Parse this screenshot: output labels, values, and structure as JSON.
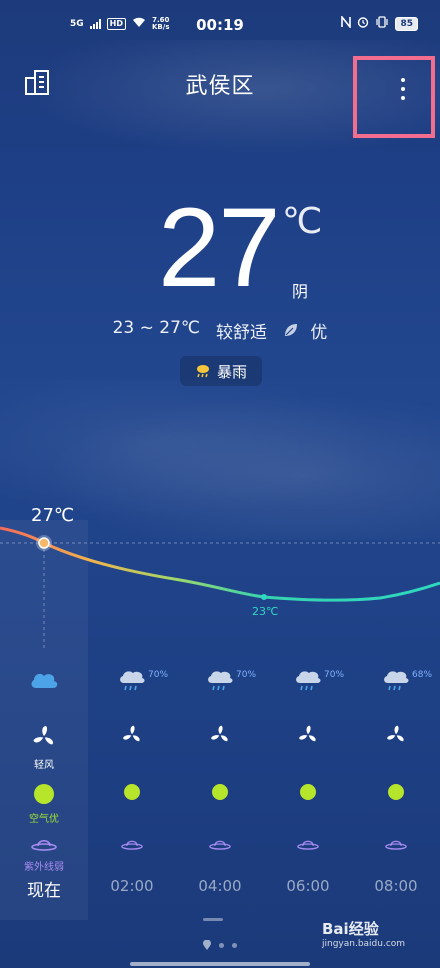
{
  "status": {
    "network": "5G",
    "hd": "HD",
    "speed_value": "7.60",
    "speed_unit": "KB/s",
    "time": "00:19",
    "battery": "85"
  },
  "header": {
    "title": "武侯区"
  },
  "current": {
    "temp": "27",
    "unit": "℃",
    "condition": "阴",
    "range": "23 ~ 27℃",
    "comfort": "较舒适",
    "air_quality": "优"
  },
  "alert": {
    "label": "暴雨"
  },
  "chart_labels": {
    "now_temp": "27℃",
    "min_temp": "23℃"
  },
  "hourly": [
    {
      "time": "现在",
      "pop": "",
      "wind": "轻风",
      "aqi": "空气优",
      "uv": "紫外线弱"
    },
    {
      "time": "02:00",
      "pop": "70%",
      "wind": "",
      "aqi": "",
      "uv": ""
    },
    {
      "time": "04:00",
      "pop": "70%",
      "wind": "",
      "aqi": "",
      "uv": ""
    },
    {
      "time": "06:00",
      "pop": "70%",
      "wind": "",
      "aqi": "",
      "uv": ""
    },
    {
      "time": "08:00",
      "pop": "68%",
      "wind": "",
      "aqi": "",
      "uv": ""
    }
  ],
  "watermark": {
    "brand": "Bai经验",
    "url": "jingyan.baidu.com"
  },
  "colors": {
    "accent_pink": "#f36d8f",
    "aqi_green": "#b6e52c",
    "uv_purple": "#a78cf2",
    "pop_blue": "#7fb2ff"
  }
}
